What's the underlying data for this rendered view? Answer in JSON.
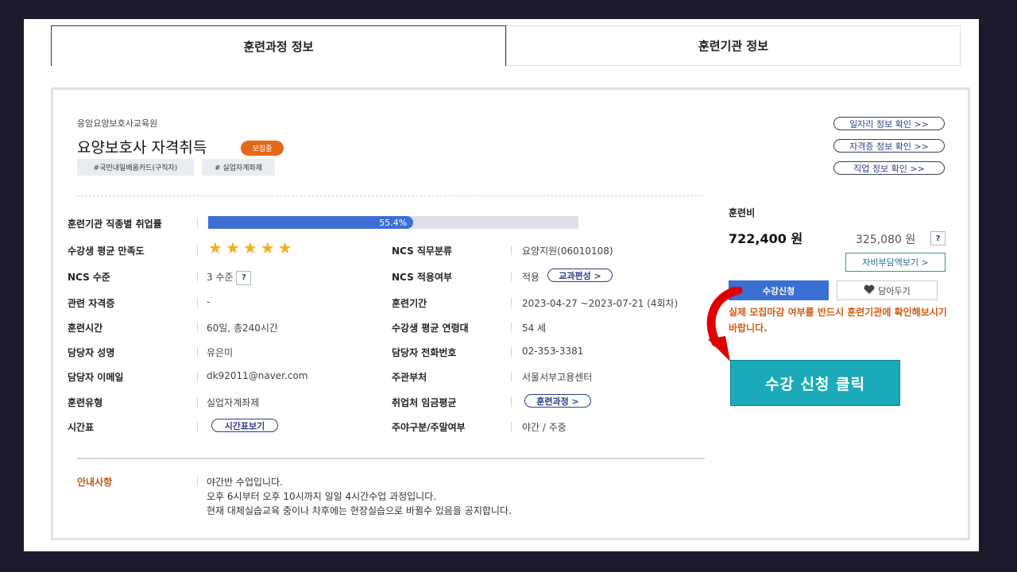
{
  "tabs": [
    {
      "label": "훈련과정 정보",
      "active": true
    },
    {
      "label": "훈련기관 정보",
      "active": false
    }
  ],
  "course": {
    "org": "응암요양보호사교육원",
    "title": "요양보호사 자격취득",
    "status_badge": "모집중",
    "tags": [
      "#국민내일배움카드(구직자)",
      "# 실업자계좌제"
    ]
  },
  "links": [
    "일자리 정보 확인 >>",
    "자격증 정보 확인 >>",
    "직업 정보 확인 >>"
  ],
  "employment": {
    "label": "훈련기관 직종별 취업률",
    "rate_text": "55.4%",
    "rate": 55.4
  },
  "rows": {
    "satisfaction_label": "수강생 평균 만족도",
    "rating": 5,
    "ncs_class_label": "NCS 직무분류",
    "ncs_class_value": "요양지원(06010108)",
    "ncs_level_label": "NCS 수준",
    "ncs_level_value": "3 수준",
    "ncs_apply_label": "NCS 적용여부",
    "ncs_apply_value": "적용",
    "ncs_apply_button": "교과편성 >",
    "cert_label": "관련 자격증",
    "cert_value": "-",
    "period_label": "훈련기간",
    "period_value": "2023-04-27 ~2023-07-21 (4회차)",
    "hours_label": "훈련시간",
    "hours_value": "60일, 총240시간",
    "age_label": "수강생 평균 연령대",
    "age_value": "54 세",
    "manager_label": "담당자 성명",
    "manager_value": "유은미",
    "phone_label": "담당자 전화번호",
    "phone_value": "02-353-3381",
    "email_label": "담당자 이메일",
    "email_value": "dk92011@naver.com",
    "agency_label": "주관부처",
    "agency_value": "서울서부고용센터",
    "type_label": "훈련유형",
    "type_value": "실업자계좌제",
    "wage_label": "취업처 임금평균",
    "wage_button": "훈련과정 >",
    "timetable_label": "시간표",
    "timetable_button": "시간표보기",
    "daynight_label": "주야구분/주말여부",
    "daynight_value": "야간 / 주중"
  },
  "help_mark": "?",
  "notice": {
    "label": "안내사항",
    "lines": [
      "야간반 수업입니다.",
      "오후 6시부터 오후 10시까지 일일 4시간수업 과정입니다.",
      "현재 대체실습교육 중이나 차후에는 현장실습으로 바뀔수 있음을 공지합니다."
    ]
  },
  "fee": {
    "label": "훈련비",
    "total": "722,400 원",
    "self_pay": "325,080 원",
    "copay_button": "자비부담액보기 >",
    "apply_button": "수강신청",
    "wishlist_button": "담아두기",
    "warning": "실제 모집마감 여부를 반드시 훈련기관에 확인해보시기 바랍니다."
  },
  "callout": {
    "text": "수강 신청 클릭"
  },
  "colors": {
    "accent_blue": "#3a6fd3",
    "badge_orange": "#e46a1b",
    "callout_teal": "#1aaab8",
    "arrow_red": "#e00000",
    "star": "#f2b01e"
  },
  "icons": {
    "heart": "heart-icon",
    "star": "star-icon",
    "arrow": "curved-arrow-icon"
  }
}
